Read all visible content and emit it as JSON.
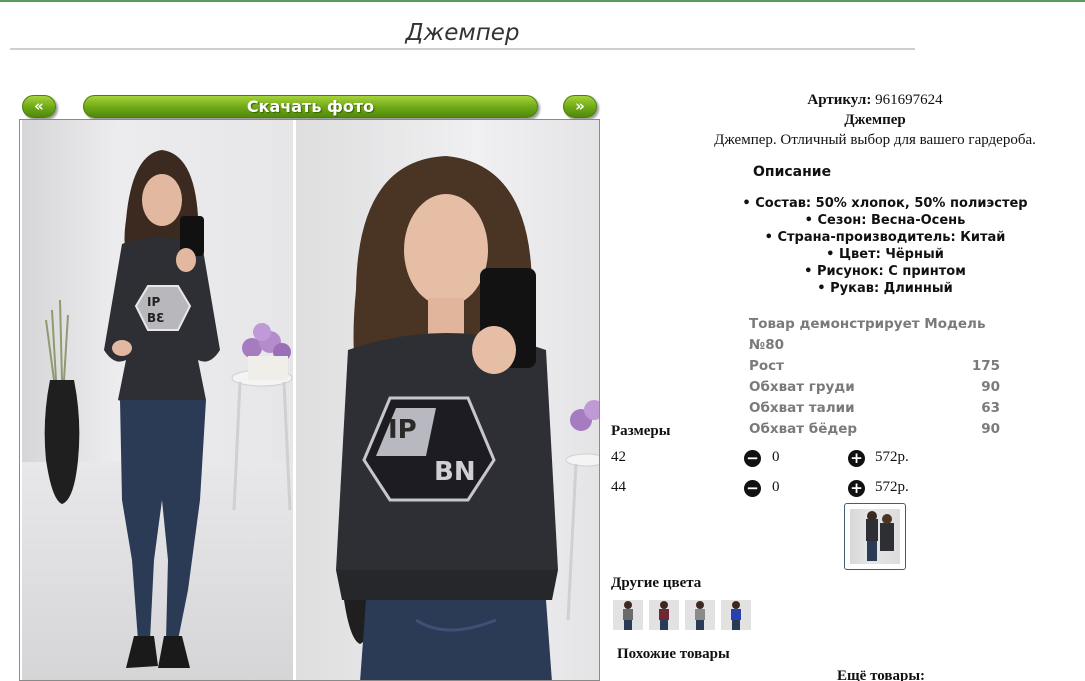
{
  "page": {
    "title": "Джемпер"
  },
  "gallery": {
    "prev_label": "«",
    "next_label": "»",
    "download_label": "Скачать фото",
    "image_count": 2
  },
  "product": {
    "sku_label": "Артикул:",
    "sku_value": "961697624",
    "name": "Джемпер",
    "short_desc": "Джемпер. Отличный выбор для вашего гардероба.",
    "desc_heading": "Описание",
    "bullets": [
      "• Состав: 50% хлопок, 50% полиэстер",
      "• Сезон: Весна-Осень",
      "• Страна-производитель: Китай",
      "• Цвет: Чёрный",
      "• Рисунок: С принтом",
      "• Рукав: Длинный"
    ]
  },
  "model": {
    "heading": "Товар демонстрирует Модель №80",
    "rows": [
      {
        "label": "Рост",
        "value": "175"
      },
      {
        "label": "Обхват груди",
        "value": "90"
      },
      {
        "label": "Обхват талии",
        "value": "63"
      },
      {
        "label": "Обхват бёдер",
        "value": "90"
      }
    ]
  },
  "sizes": {
    "heading": "Размеры",
    "rows": [
      {
        "size": "42",
        "qty": "0",
        "price": "572р."
      },
      {
        "size": "44",
        "qty": "0",
        "price": "572р."
      }
    ]
  },
  "other_colors": {
    "heading": "Другие цвета",
    "swatches": [
      "grey",
      "burgundy",
      "light-grey",
      "blue"
    ],
    "swatch_colors": [
      "#6b6b6b",
      "#6d2a36",
      "#8a8a8a",
      "#2a3fb0"
    ]
  },
  "similar": {
    "heading": "Похожие товары",
    "more_label": "Ещё товары:"
  },
  "colors": {
    "accent": "#6ea716",
    "sweater": "#2e2f34",
    "jeans": "#2b3a55"
  }
}
